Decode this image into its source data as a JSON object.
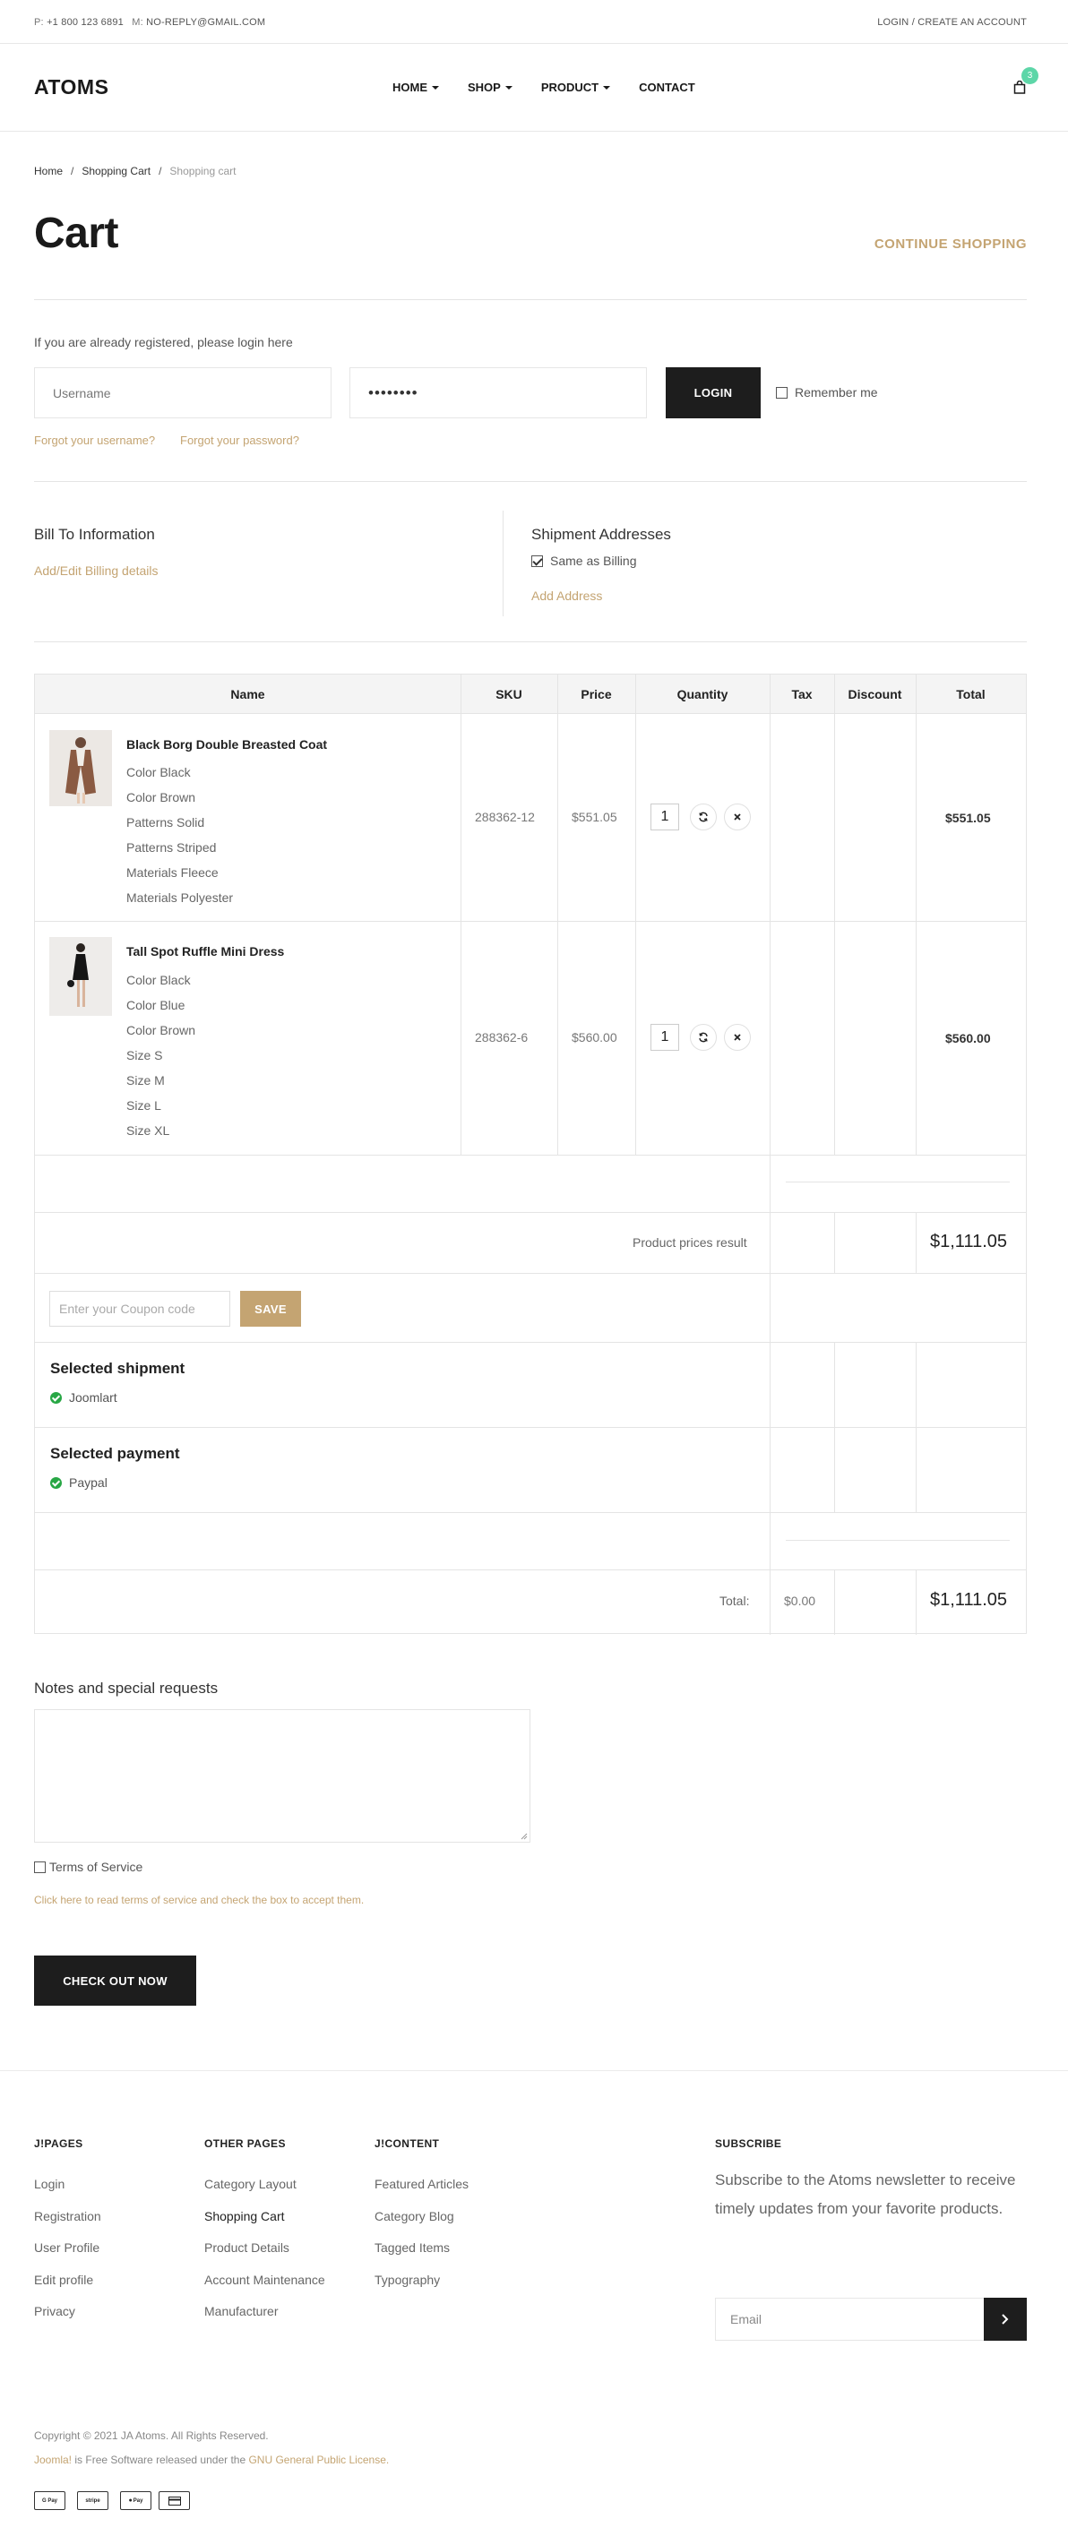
{
  "topbar": {
    "phone_prefix": "P:",
    "phone": "+1 800 123 6891",
    "mail_prefix": "M:",
    "email": "NO-REPLY@GMAIL.COM",
    "login_link": "LOGIN / CREATE AN ACCOUNT"
  },
  "header": {
    "logo": "ATOMS",
    "nav": [
      {
        "label": "HOME"
      },
      {
        "label": "SHOP"
      },
      {
        "label": "PRODUCT"
      },
      {
        "label": "CONTACT"
      }
    ],
    "cart_count": "3"
  },
  "breadcrumb": {
    "home": "Home",
    "sep": "/",
    "shopping_cart": "Shopping Cart",
    "current": "Shopping cart"
  },
  "page": {
    "title": "Cart",
    "continue_shopping": "CONTINUE SHOPPING"
  },
  "login": {
    "note": "If you are already registered, please login here",
    "username_placeholder": "Username",
    "password_value": "••••••••",
    "login_button": "LOGIN",
    "remember_label": "Remember me",
    "forgot_username": "Forgot your username?",
    "forgot_password": "Forgot your password?"
  },
  "billing": {
    "title": "Bill To Information",
    "edit_link": "Add/Edit Billing details"
  },
  "shipment": {
    "title": "Shipment Addresses",
    "same_as_billing": "Same as Billing",
    "add_address": "Add Address"
  },
  "table": {
    "headers": [
      "Name",
      "SKU",
      "Price",
      "Quantity",
      "Tax",
      "Discount",
      "Total"
    ],
    "items": [
      {
        "name": "Black Borg Double Breasted Coat",
        "attributes": [
          "Color Black",
          "Color Brown",
          "Patterns Solid",
          "Patterns Striped",
          "Materials Fleece",
          "Materials Polyester"
        ],
        "sku": "288362-12",
        "price": "$551.05",
        "quantity": "1",
        "total": "$551.05"
      },
      {
        "name": "Tall Spot Ruffle Mini Dress",
        "attributes": [
          "Color Black",
          "Color Blue",
          "Color Brown",
          "Size S",
          "Size M",
          "Size L",
          "Size XL"
        ],
        "sku": "288362-6",
        "price": "$560.00",
        "quantity": "1",
        "total": "$560.00"
      }
    ],
    "product_prices_label": "Product prices result",
    "product_prices_total": "$1,111.05",
    "coupon_placeholder": "Enter your Coupon code",
    "save_button": "SAVE",
    "selected_shipment_title": "Selected shipment",
    "selected_shipment_value": "Joomlart",
    "selected_payment_title": "Selected payment",
    "selected_payment_value": "Paypal",
    "total_label": "Total:",
    "total_tax": "$0.00",
    "grand_total": "$1,111.05"
  },
  "notes": {
    "title": "Notes and special requests",
    "terms_label": "Terms of Service",
    "terms_link": "Click here to read terms of service and check the box to accept them.",
    "checkout_button": "CHECK OUT NOW"
  },
  "footer": {
    "columns": [
      {
        "title": "J!PAGES",
        "links": [
          "Login",
          "Registration",
          "User Profile",
          "Edit profile",
          "Privacy"
        ]
      },
      {
        "title": "OTHER PAGES",
        "links": [
          "Category Layout",
          "Shopping Cart",
          "Product Details",
          "Account Maintenance",
          "Manufacturer"
        ]
      },
      {
        "title": "J!CONTENT",
        "links": [
          "Featured Articles",
          "Category Blog",
          "Tagged Items",
          "Typography"
        ]
      }
    ],
    "subscribe_title": "SUBSCRIBE",
    "subscribe_text": "Subscribe to the Atoms newsletter to receive timely updates from your favorite products.",
    "email_placeholder": "Email",
    "copyright": "Copyright © 2021 JA Atoms. All Rights Reserved.",
    "license_prefix": "Joomla!",
    "license_middle": " is Free Software released under the ",
    "license_link": "GNU General Public License.",
    "payment_icons": [
      "G Pay",
      "stripe",
      "Pay",
      "card"
    ]
  },
  "colors": {
    "accent": "#c4a472",
    "dark": "#1d1d1d",
    "badge": "#5dd6a8",
    "success": "#28a745"
  }
}
